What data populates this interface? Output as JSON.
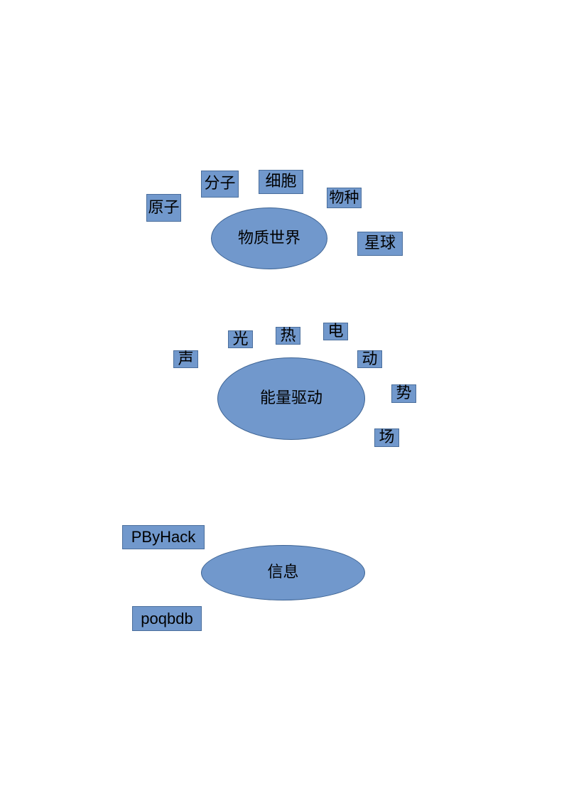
{
  "diagram": {
    "groups": [
      {
        "center": "物质世界",
        "items": [
          "原子",
          "分子",
          "细胞",
          "物种",
          "星球"
        ]
      },
      {
        "center": "能量驱动",
        "items": [
          "声",
          "光",
          "热",
          "电",
          "动",
          "势",
          "场"
        ]
      },
      {
        "center": "信息",
        "items": [
          "PByHack",
          "poqbdb"
        ]
      }
    ]
  },
  "colors": {
    "shape_fill": "#7198cc",
    "shape_border": "#4a6e9c",
    "text": "#000000",
    "background": "#ffffff"
  }
}
